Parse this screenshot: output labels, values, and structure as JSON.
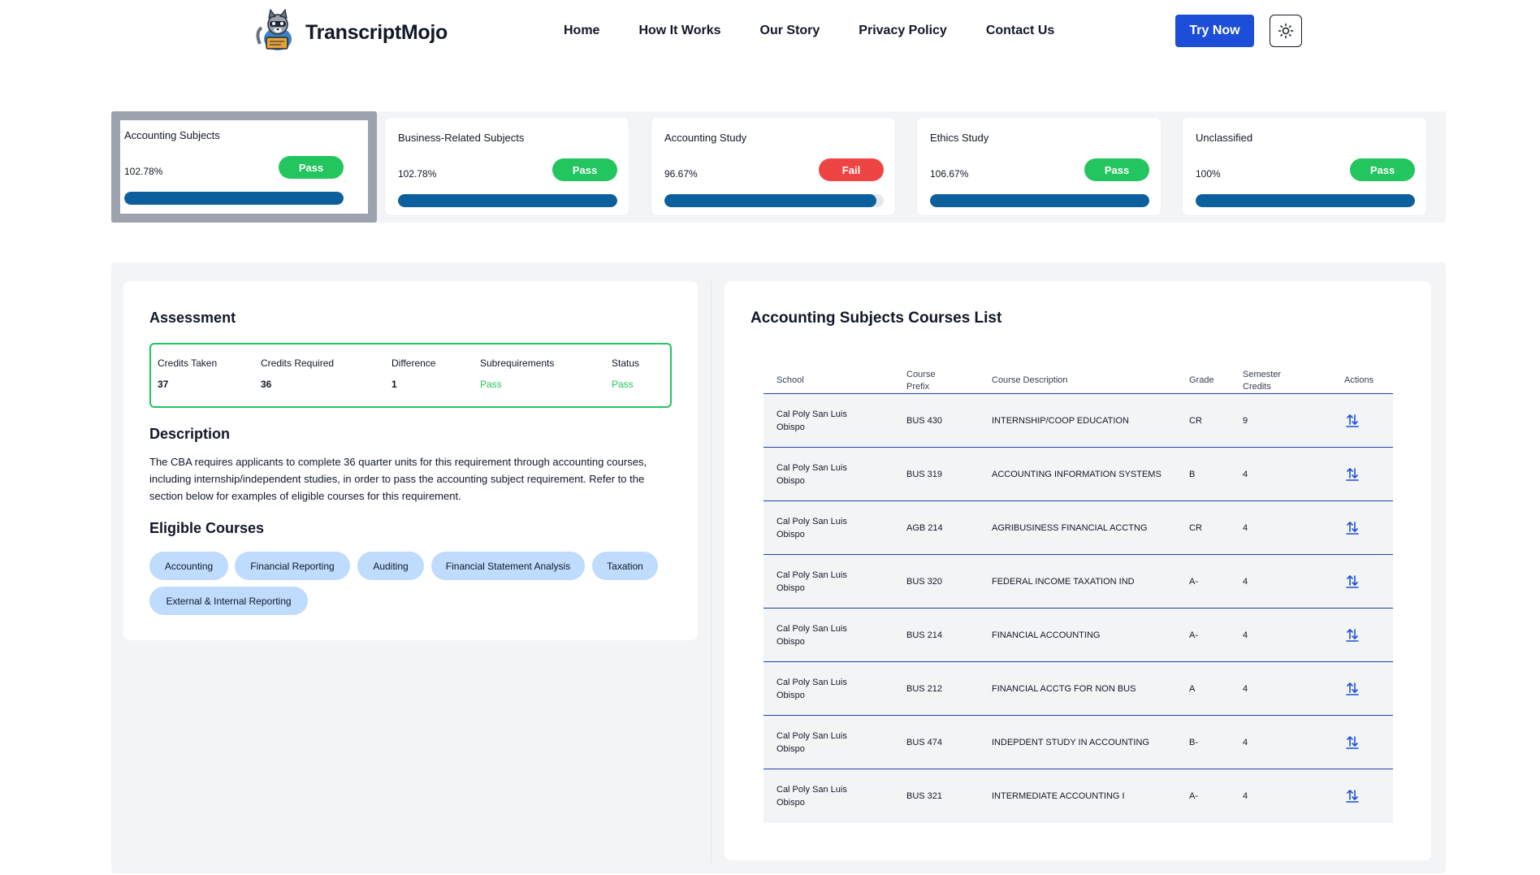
{
  "app": {
    "brand": "TranscriptMojo"
  },
  "nav": {
    "items": [
      "Home",
      "How It Works",
      "Our Story",
      "Privacy Policy",
      "Contact Us"
    ],
    "try_label": "Try Now"
  },
  "icons": {
    "logo": "raccoon-logo-icon",
    "theme": "sun-icon",
    "action": "swap-arrows-icon"
  },
  "colors": {
    "pass": "#22c55e",
    "fail": "#ef4444",
    "bar": "#0b5f9c",
    "primary": "#1d4ed8",
    "chip": "#bfdbfe"
  },
  "categories": [
    {
      "title": "Accounting Subjects",
      "percent": "102.78%",
      "status": "Pass",
      "progress": 1.0,
      "selected": true
    },
    {
      "title": "Business-Related Subjects",
      "percent": "102.78%",
      "status": "Pass",
      "progress": 1.0,
      "selected": false
    },
    {
      "title": "Accounting Study",
      "percent": "96.67%",
      "status": "Fail",
      "progress": 0.9667,
      "selected": false
    },
    {
      "title": "Ethics Study",
      "percent": "106.67%",
      "status": "Pass",
      "progress": 1.0,
      "selected": false
    },
    {
      "title": "Unclassified",
      "percent": "100%",
      "status": "Pass",
      "progress": 1.0,
      "selected": false
    }
  ],
  "assessment": {
    "heading": "Assessment",
    "columns": [
      {
        "label": "Credits Taken",
        "value": "37"
      },
      {
        "label": "Credits Required",
        "value": "36"
      },
      {
        "label": "Difference",
        "value": "1"
      },
      {
        "label": "Subrequirements",
        "value": "Pass"
      },
      {
        "label": "Status",
        "value": "Pass"
      }
    ]
  },
  "description": {
    "heading": "Description",
    "text": "The CBA requires applicants to complete 36 quarter units for this requirement through accounting courses, including internship/independent studies, in order to pass the accounting subject requirement. Refer to the section below for examples of eligible courses for this requirement."
  },
  "eligible": {
    "heading": "Eligible Courses",
    "chips": [
      "Accounting",
      "Financial Reporting",
      "Auditing",
      "Financial Statement Analysis",
      "Taxation",
      "External & Internal Reporting"
    ]
  },
  "courses": {
    "heading": "Accounting Subjects Courses List",
    "headers": [
      "School",
      "Course Prefix",
      "Course Description",
      "Grade",
      "Semester Credits",
      "Actions"
    ],
    "rows": [
      {
        "school": "Cal Poly San Luis Obispo",
        "prefix": "BUS 430",
        "description": "INTERNSHIP/COOP EDUCATION",
        "grade": "CR",
        "credits": "9"
      },
      {
        "school": "Cal Poly San Luis Obispo",
        "prefix": "BUS 319",
        "description": "ACCOUNTING INFORMATION SYSTEMS",
        "grade": "B",
        "credits": "4"
      },
      {
        "school": "Cal Poly San Luis Obispo",
        "prefix": "AGB 214",
        "description": "AGRIBUSINESS FINANCIAL ACCTNG",
        "grade": "CR",
        "credits": "4"
      },
      {
        "school": "Cal Poly San Luis Obispo",
        "prefix": "BUS 320",
        "description": "FEDERAL INCOME TAXATION IND",
        "grade": "A-",
        "credits": "4"
      },
      {
        "school": "Cal Poly San Luis Obispo",
        "prefix": "BUS 214",
        "description": "FINANCIAL ACCOUNTING",
        "grade": "A-",
        "credits": "4"
      },
      {
        "school": "Cal Poly San Luis Obispo",
        "prefix": "BUS 212",
        "description": "FINANCIAL ACCTG FOR NON BUS",
        "grade": "A",
        "credits": "4"
      },
      {
        "school": "Cal Poly San Luis Obispo",
        "prefix": "BUS 474",
        "description": "INDEPDENT STUDY IN ACCOUNTING",
        "grade": "B-",
        "credits": "4"
      },
      {
        "school": "Cal Poly San Luis Obispo",
        "prefix": "BUS 321",
        "description": "INTERMEDIATE ACCOUNTING I",
        "grade": "A-",
        "credits": "4"
      }
    ]
  }
}
